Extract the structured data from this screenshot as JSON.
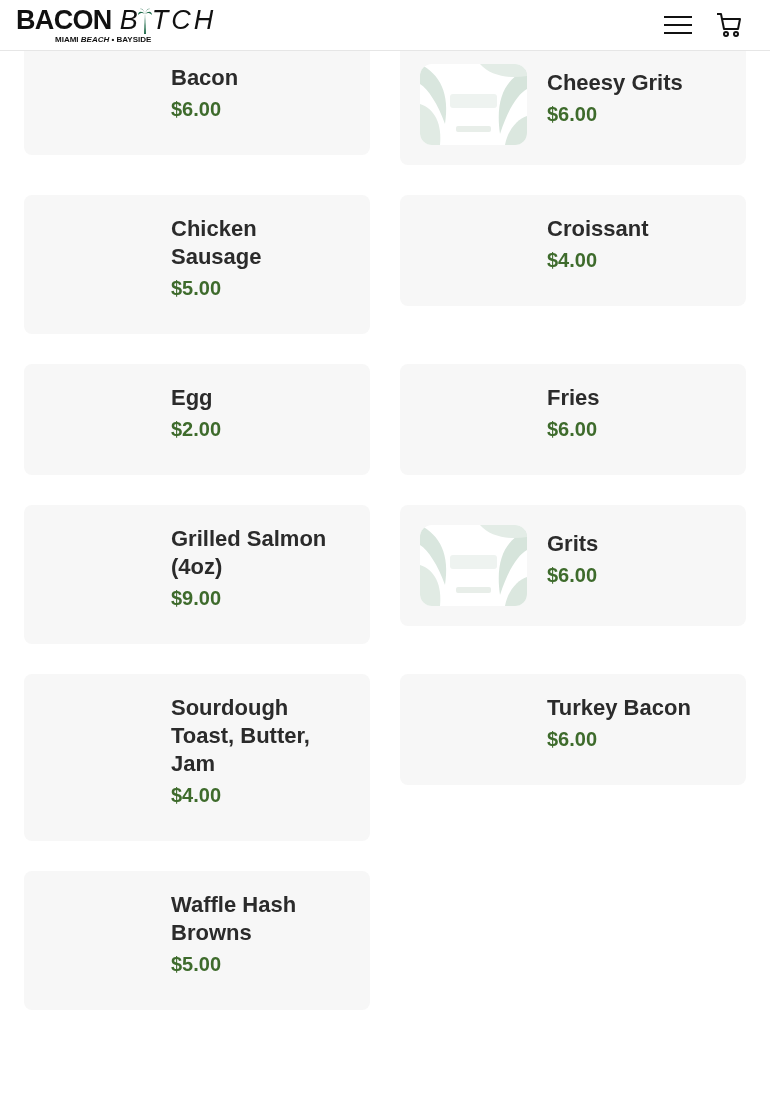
{
  "header": {
    "logo": {
      "word_bold": "BACON",
      "word_light_start": "B",
      "word_light_end": "TCH",
      "tagline": "MIAMI *BEACH* • BAYSIDE"
    }
  },
  "items": [
    {
      "name": "Bacon",
      "price": "$6.00"
    },
    {
      "name": "Cheesy Grits",
      "price": "$6.00"
    },
    {
      "name": "Chicken Sausage",
      "price": "$5.00"
    },
    {
      "name": "Croissant",
      "price": "$4.00"
    },
    {
      "name": "Egg",
      "price": "$2.00"
    },
    {
      "name": "Fries",
      "price": "$6.00"
    },
    {
      "name": "Grilled Salmon (4oz)",
      "price": "$9.00"
    },
    {
      "name": "Grits",
      "price": "$6.00"
    },
    {
      "name": "Sourdough Toast, Butter, Jam",
      "price": "$4.00"
    },
    {
      "name": "Turkey Bacon",
      "price": "$6.00"
    },
    {
      "name": "Waffle Hash Browns",
      "price": "$5.00"
    }
  ]
}
